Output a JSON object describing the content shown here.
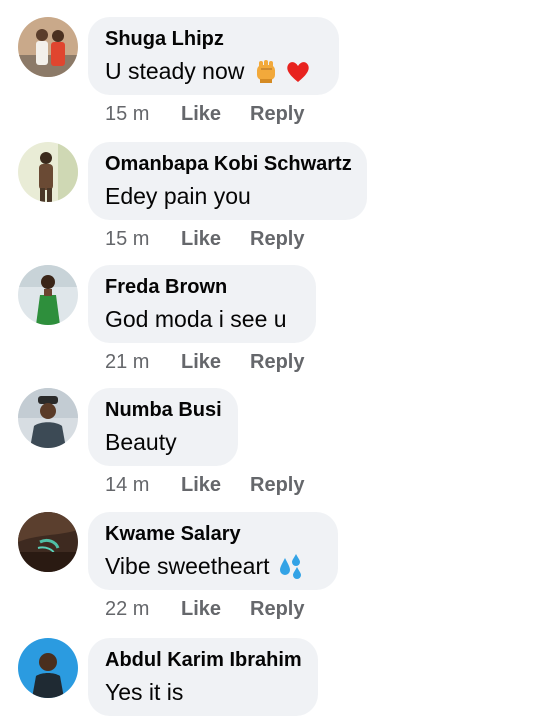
{
  "comments": [
    {
      "author": "Shuga Lhipz",
      "text": "U steady now",
      "emoji": [
        "fist-emoji",
        "red-heart-emoji"
      ],
      "time": "15 m",
      "like": "Like",
      "reply": "Reply"
    },
    {
      "author": "Omanbapa Kobi Schwartz",
      "text": "Edey pain you",
      "emoji": [],
      "time": "15 m",
      "like": "Like",
      "reply": "Reply"
    },
    {
      "author": "Freda Brown",
      "text": "God moda i see u",
      "emoji": [],
      "time": "21 m",
      "like": "Like",
      "reply": "Reply"
    },
    {
      "author": "Numba Busi",
      "text": "Beauty",
      "emoji": [],
      "time": "14 m",
      "like": "Like",
      "reply": "Reply"
    },
    {
      "author": "Kwame Salary",
      "text": "Vibe sweetheart",
      "emoji": [
        "sweat-droplets-emoji"
      ],
      "time": "22 m",
      "like": "Like",
      "reply": "Reply"
    },
    {
      "author": "Abdul Karim Ibrahim",
      "text": "Yes it is",
      "emoji": [],
      "time": "",
      "like": "",
      "reply": ""
    }
  ],
  "colors": {
    "bubble_bg": "#f0f2f5",
    "author_text": "#050505",
    "meta_text": "#65676b"
  }
}
